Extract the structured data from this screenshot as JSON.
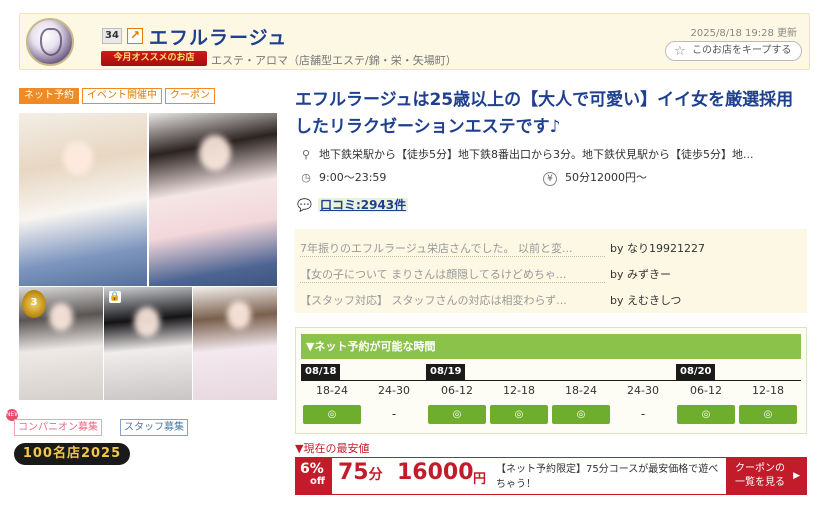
{
  "header": {
    "rank": "34",
    "shop_name": "エフルラージュ",
    "badge": "今月オススメのお店",
    "genre": "エステ・アロマ（店舗型エステ/錦・栄・矢場町）",
    "updated": "2025/8/18 19:28 更新",
    "keep_label": "このお店をキープする",
    "icons": [
      "shop-logo",
      "arrow-up-right-icon",
      "star-icon"
    ]
  },
  "tags": [
    "ネット予約",
    "イベント開催中",
    "クーポン"
  ],
  "recruit": {
    "companion": "コンパニオン募集",
    "staff": "スタッフ募集",
    "new_badge": "NEW",
    "meiten": "100名店2025"
  },
  "headline": "エフルラージュは25歳以上の【大人で可愛い】イイ女を厳選採用したリラクゼーションエステです♪",
  "info": {
    "access": "地下鉄栄駅から【徒歩5分】地下鉄8番出口から3分。地下鉄伏見駅から【徒歩5分】地...",
    "hours": "9:00〜23:59",
    "price": "50分12000円〜",
    "kuchikomi": "口コミ:2943件",
    "icons": [
      "map-pin-icon",
      "clock-icon",
      "yen-icon",
      "speech-bubble-icon"
    ]
  },
  "reviews": [
    {
      "text": "7年振りのエフルラージュ栄店さんでした。 以前と変...",
      "by": "by なり19921227"
    },
    {
      "text": "【女の子について まりさんは顔隠してるけどめちゃ...",
      "by": "by みずきー"
    },
    {
      "text": "【スタッフ対応】 スタッフさんの対応は相変わらず...",
      "by": "by えむきしつ"
    }
  ],
  "reservation": {
    "title": "▼ネット予約が可能な時間",
    "dates": [
      "08/18",
      "08/19",
      "08/20"
    ],
    "slots": [
      {
        "label": "18-24",
        "status": "◎"
      },
      {
        "label": "24-30",
        "status": "-"
      },
      {
        "label": "06-12",
        "status": "◎"
      },
      {
        "label": "12-18",
        "status": "◎"
      },
      {
        "label": "18-24",
        "status": "◎"
      },
      {
        "label": "24-30",
        "status": "-"
      },
      {
        "label": "06-12",
        "status": "◎"
      },
      {
        "label": "12-18",
        "status": "◎"
      }
    ]
  },
  "price": {
    "label": "▼現在の最安値",
    "discount_pct": "6%",
    "discount_off": "off",
    "minutes": "75",
    "minutes_unit": "分",
    "amount": "16000",
    "yen": "円",
    "desc": "【ネット予約限定】75分コースが最安価格で遊べちゃう！",
    "coupon_btn_line1": "クーポンの",
    "coupon_btn_line2": "一覧を見る"
  }
}
